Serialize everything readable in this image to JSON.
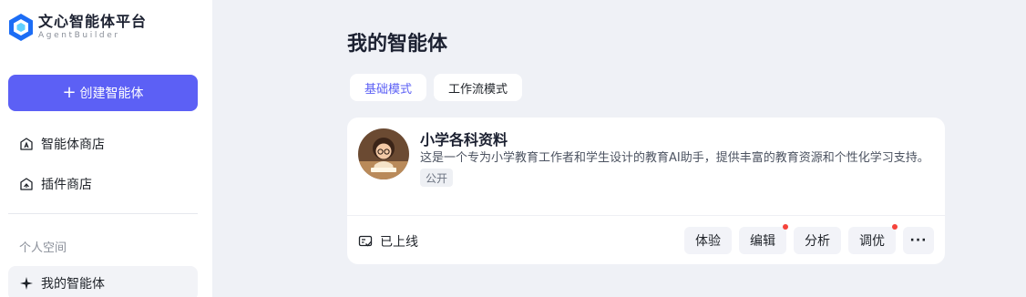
{
  "brand": {
    "title": "文心智能体平台",
    "subtitle": "AgentBuilder"
  },
  "sidebar": {
    "create_label": "创建智能体",
    "items": [
      {
        "label": "智能体商店",
        "icon": "store-icon"
      },
      {
        "label": "插件商店",
        "icon": "plugin-icon"
      }
    ],
    "section_label": "个人空间",
    "mine_label": "我的智能体"
  },
  "main": {
    "title": "我的智能体",
    "tabs": [
      {
        "label": "基础模式",
        "active": true
      },
      {
        "label": "工作流模式",
        "active": false
      }
    ],
    "card": {
      "name": "小学各科资料",
      "description": "这是一个专为小学教育工作者和学生设计的教育AI助手，提供丰富的教育资源和个性化学习支持。",
      "badge": "公开",
      "status": "已上线",
      "actions": [
        {
          "label": "体验",
          "dot": false
        },
        {
          "label": "编辑",
          "dot": true
        },
        {
          "label": "分析",
          "dot": false
        },
        {
          "label": "调优",
          "dot": true
        }
      ],
      "more_label": "···"
    }
  },
  "colors": {
    "accent": "#5c60f5",
    "dot": "#f5433b",
    "background": "#eff1f6"
  }
}
